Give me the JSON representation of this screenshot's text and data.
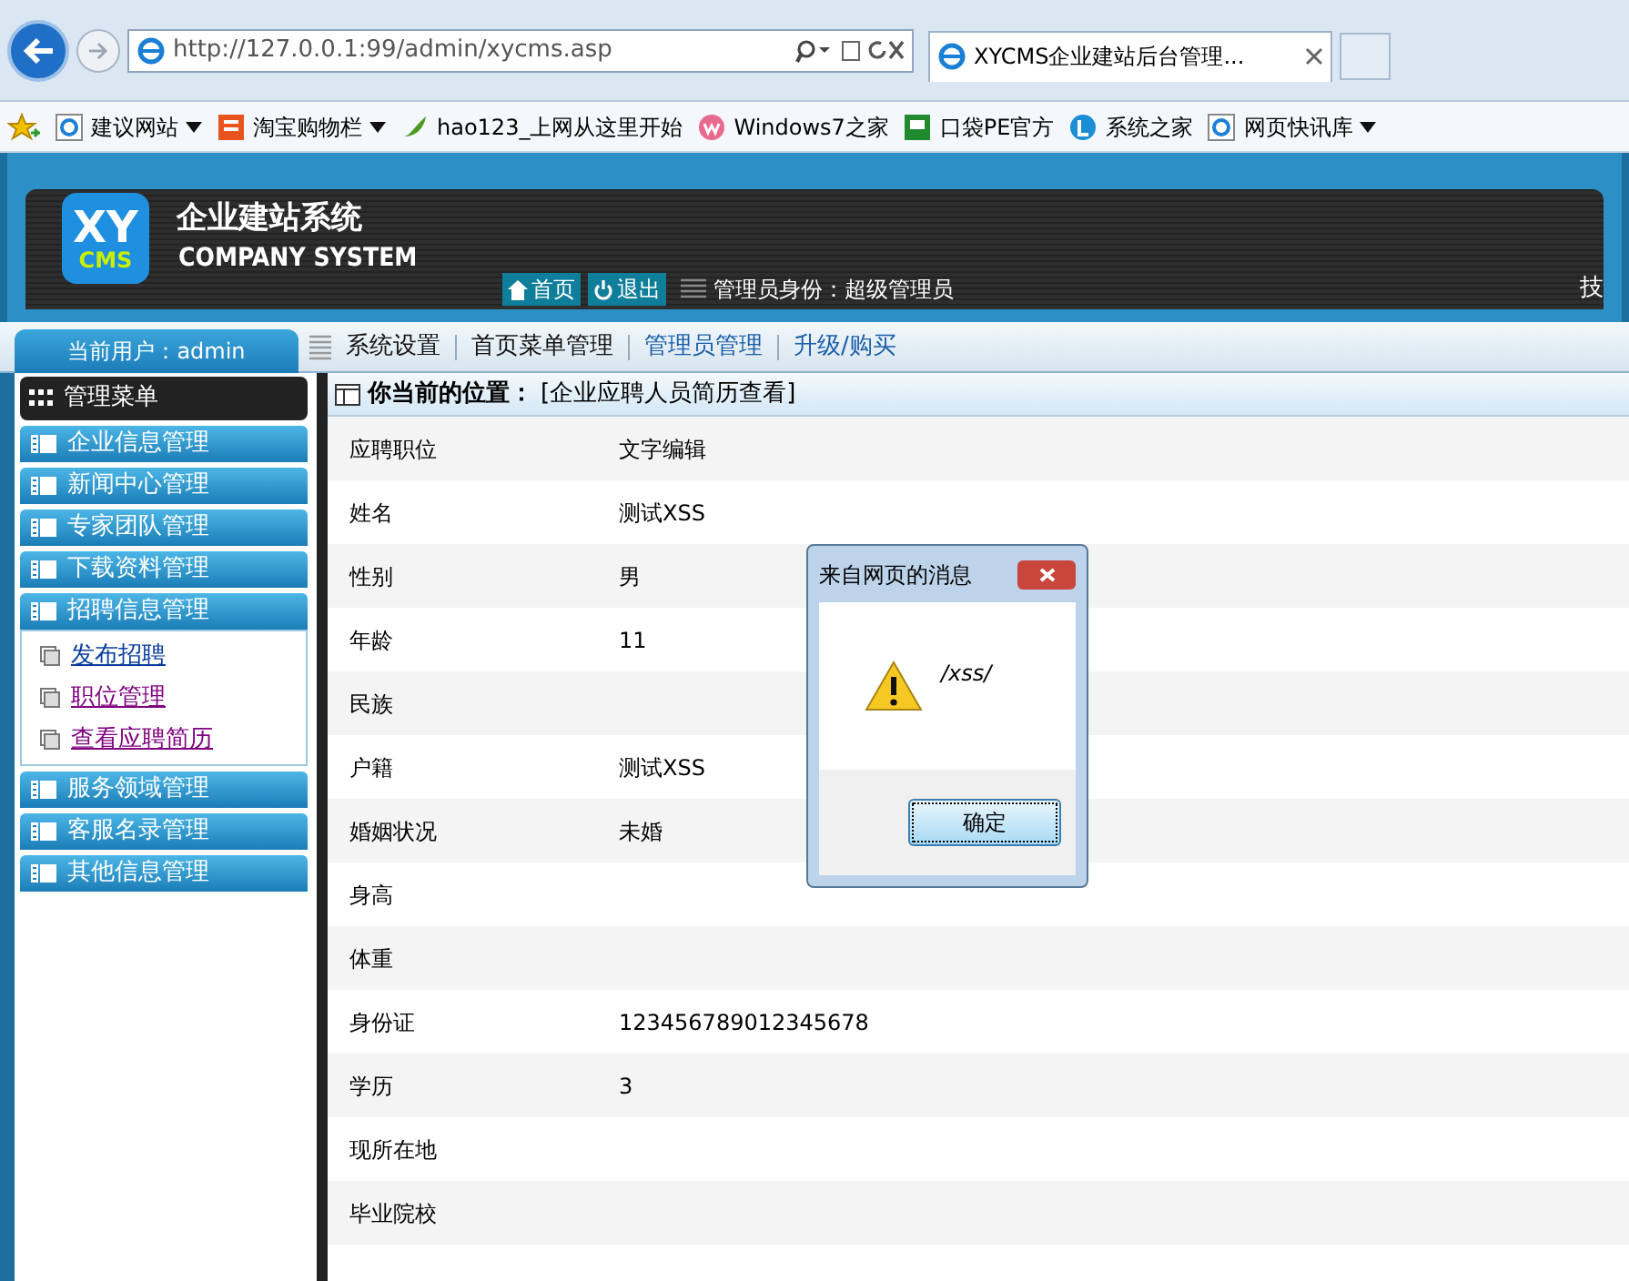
{
  "browser": {
    "url": "http://127.0.0.1:99/admin/xycms.asp",
    "tab_title": "XYCMS企业建站后台管理...",
    "favorites": [
      {
        "label": "建议网站",
        "dropdown": true
      },
      {
        "label": "淘宝购物栏",
        "dropdown": true
      },
      {
        "label": "hao123_上网从这里开始",
        "dropdown": false
      },
      {
        "label": "Windows7之家",
        "dropdown": false
      },
      {
        "label": "口袋PE官方",
        "dropdown": false
      },
      {
        "label": "系统之家",
        "dropdown": false
      },
      {
        "label": "网页快讯库",
        "dropdown": true
      }
    ]
  },
  "header": {
    "logo_top": "XY",
    "logo_bottom": "CMS",
    "title": "企业建站系统",
    "subtitle": "COMPANY SYSTEM",
    "buttons": [
      "首页",
      "退出"
    ],
    "role": "管理员身份：超级管理员",
    "right_text": "技"
  },
  "current_user": "当前用户：admin",
  "nav": [
    {
      "label": "系统设置",
      "kind": "plain"
    },
    {
      "label": "首页菜单管理",
      "kind": "plain"
    },
    {
      "label": "管理员管理",
      "kind": "link"
    },
    {
      "label": "升级/购买",
      "kind": "link"
    }
  ],
  "sidebar": {
    "title": "管理菜单",
    "menus": [
      {
        "label": "企业信息管理"
      },
      {
        "label": "新闻中心管理"
      },
      {
        "label": "专家团队管理"
      },
      {
        "label": "下载资料管理"
      },
      {
        "label": "招聘信息管理",
        "children": [
          {
            "label": "发布招聘",
            "visited": false
          },
          {
            "label": "职位管理",
            "visited": true
          },
          {
            "label": "查看应聘简历",
            "visited": true
          }
        ]
      },
      {
        "label": "服务领域管理"
      },
      {
        "label": "客服名录管理"
      },
      {
        "label": "其他信息管理"
      }
    ]
  },
  "breadcrumb": {
    "label": "你当前的位置：",
    "value": "[企业应聘人员简历查看]"
  },
  "fields": [
    {
      "label": "应聘职位",
      "value": "文字编辑"
    },
    {
      "label": "姓名",
      "value": "测试XSS"
    },
    {
      "label": "性别",
      "value": "男"
    },
    {
      "label": "年龄",
      "value": "11"
    },
    {
      "label": "民族"
    },
    {
      "label": "户籍",
      "value": "测试XSS"
    },
    {
      "label": "婚姻状况",
      "value": "未婚"
    },
    {
      "label": "身高"
    },
    {
      "label": "体重"
    },
    {
      "label": "身份证",
      "value": "123456789012345678"
    },
    {
      "label": "学历",
      "value": "3"
    },
    {
      "label": "现所在地"
    },
    {
      "label": "毕业院校"
    }
  ],
  "dialog": {
    "title": "来自网页的消息",
    "message": "/xss/",
    "button": "确定"
  }
}
